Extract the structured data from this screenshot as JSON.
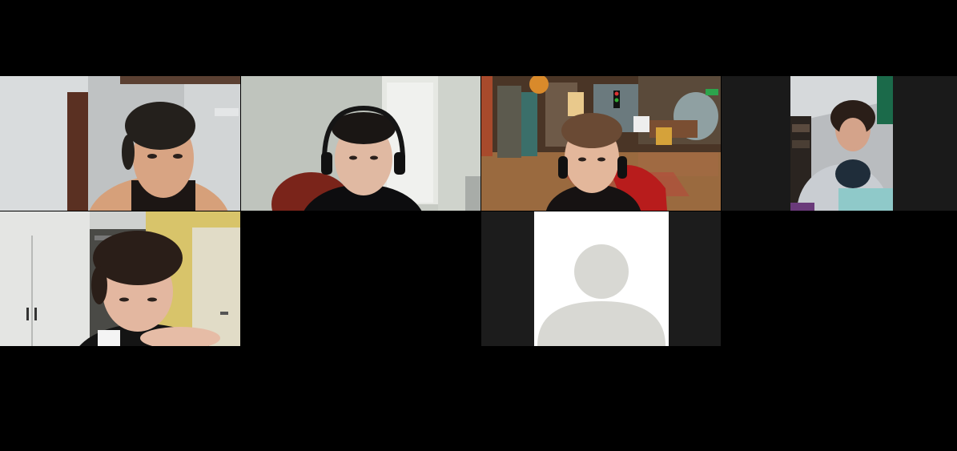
{
  "meeting": {
    "layout": "gallery-view",
    "participants": [
      {
        "tile": "participant-tile-1",
        "video": "on"
      },
      {
        "tile": "participant-tile-2",
        "video": "on"
      },
      {
        "tile": "participant-tile-3",
        "video": "on"
      },
      {
        "tile": "participant-tile-4",
        "video": "on"
      },
      {
        "tile": "participant-tile-5",
        "video": "on"
      },
      {
        "tile": "participant-tile-6",
        "video": "off",
        "placeholder": "default-avatar-icon"
      }
    ]
  },
  "colors": {
    "background": "#000000",
    "avatar_bg": "#ffffff",
    "avatar_silhouette": "#d8d8d3",
    "tile_letterbox": "#1c1c1c"
  }
}
